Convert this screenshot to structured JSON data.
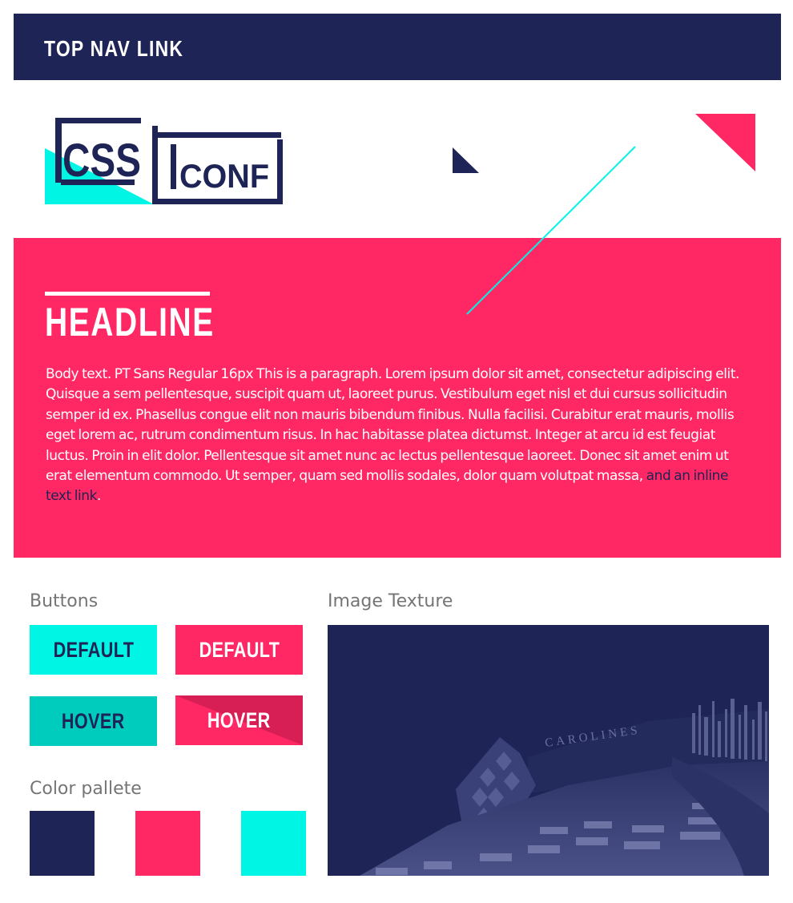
{
  "nav": {
    "link_label": "TOP NAV LINK"
  },
  "logo": {
    "part1": "CSS",
    "part2": "CONF"
  },
  "hero": {
    "headline": "HEADLINE",
    "body": "Body text. PT Sans Regular 16px This is a paragraph. Lorem ipsum dolor sit amet, consectetur adipiscing elit. Quisque a sem pellentesque, suscipit quam ut, laoreet purus. Vestibulum eget nisl et dui cursus sollicitudin semper id ex. Phasellus congue elit non mauris bibendum finibus. Nulla facilisi. Curabitur erat mauris, mollis eget lorem ac, rutrum condimentum risus. In hac habitasse platea dictumst. Integer at arcu id est feugiat luctus. Proin in elit dolor. Pellentesque sit amet nunc ac lectus pellentesque laoreet. Donec sit amet enim ut erat elementum commodo. Ut semper, quam sed mollis sodales, dolor quam volutpat massa, ",
    "inline_link": "and an inline text link",
    "body_end": "."
  },
  "buttons_section": {
    "title": "Buttons",
    "cyan_default": "DEFAULT",
    "pink_default": "DEFAULT",
    "cyan_hover": "HOVER",
    "pink_hover": "HOVER"
  },
  "palette_section": {
    "title": "Color pallete",
    "colors": [
      "#1e2455",
      "#ff2864",
      "#00f5e4"
    ]
  },
  "texture_section": {
    "title": "Image Texture",
    "sign_text": "CAROLINES"
  },
  "theme": {
    "navy": "#1e2455",
    "pink": "#ff2864",
    "cyan": "#00f5e4",
    "cyan_hover": "#00ccbe",
    "pink_hover_shade": "#d81f55"
  }
}
